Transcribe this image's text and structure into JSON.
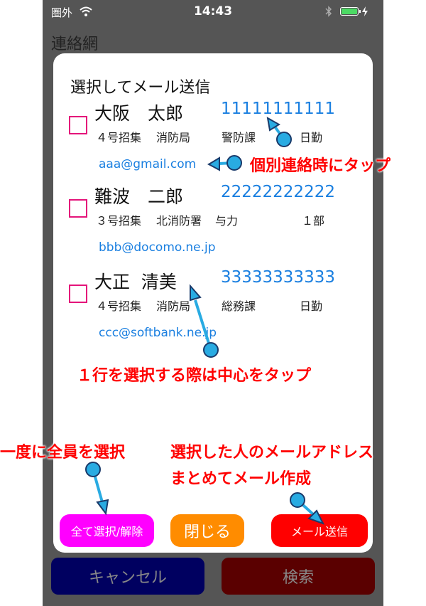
{
  "status_bar": {
    "carrier": "圏外",
    "time": "14:43"
  },
  "nav": {
    "title": "連絡網"
  },
  "background_buttons": {
    "cancel": "キャンセル",
    "search": "検索"
  },
  "dialog": {
    "title": "選択してメール送信",
    "contacts": [
      {
        "name": "大阪　太郎",
        "phone": "11111111111",
        "group": "４号招集",
        "station": "消防局",
        "section": "警防課",
        "shift": "日勤",
        "email": "aaa@gmail.com"
      },
      {
        "name": "難波　二郎",
        "phone": "22222222222",
        "group": "３号招集",
        "station": "北消防署",
        "section": "与力",
        "shift": "１部",
        "email": "bbb@docomo.ne.jp"
      },
      {
        "name": "大正  清美",
        "phone": "33333333333",
        "group": "４号招集",
        "station": "消防局",
        "section": "総務課",
        "shift": "日勤",
        "email": "ccc@softbank.ne.jp"
      }
    ],
    "buttons": {
      "select_all": "全て選択/解除",
      "close": "閉じる",
      "send": "メール送信"
    }
  },
  "annotations": {
    "individual": "個別連絡時にタップ",
    "row_select": "１行を選択する際は中心をタップ",
    "select_all": "一度に全員を選択",
    "send_line1": "選択した人のメールアドレス",
    "send_line2": "まとめてメール作成"
  },
  "colors": {
    "checkbox": "#e4147a",
    "link": "#1a7fe0",
    "select_all_button": "#ff00ff",
    "close_button": "#ff8c00",
    "send_button": "#ff0000",
    "annotation_text": "#ff0000",
    "arrow": "#29abe2"
  },
  "icons": [
    "wifi-icon",
    "bluetooth-icon",
    "battery-icon",
    "charging-icon",
    "checkbox-icon"
  ]
}
